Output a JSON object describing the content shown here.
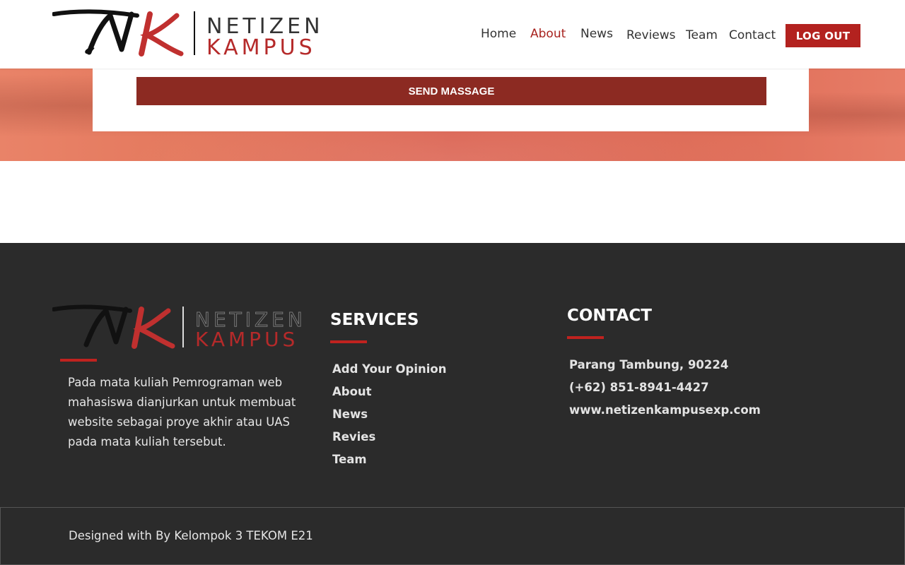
{
  "brand": {
    "logo_top": "NETIZEN",
    "logo_bottom": "KAMPUS",
    "accent_color": "#b3221f",
    "icon": "nk-script-logo-icon"
  },
  "nav": {
    "items": [
      {
        "label": "Home",
        "active": false
      },
      {
        "label": "About",
        "active": true
      },
      {
        "label": "News",
        "active": false
      },
      {
        "label": "Reviews",
        "active": false
      },
      {
        "label": "Team",
        "active": false
      },
      {
        "label": "Contact",
        "active": false
      }
    ],
    "logout_label": "LOG OUT"
  },
  "form": {
    "send_label": "SEND MASSAGE"
  },
  "footer": {
    "about_text": "Pada mata kuliah Pemrograman web mahasiswa dianjurkan untuk membuat website sebagai proye akhir atau UAS pada mata kuliah tersebut.",
    "services": {
      "heading": "SERVICES",
      "links": [
        "Add Your Opinion",
        "About",
        "News",
        "Revies",
        "Team"
      ]
    },
    "contact": {
      "heading": "CONTACT",
      "address": "Parang Tambung, 90224",
      "phone": "(+62) 851-8941-4427",
      "website": "www.netizenkampusexp.com"
    },
    "copyright": "Designed with By Kelompok 3 TEKOM E21"
  }
}
